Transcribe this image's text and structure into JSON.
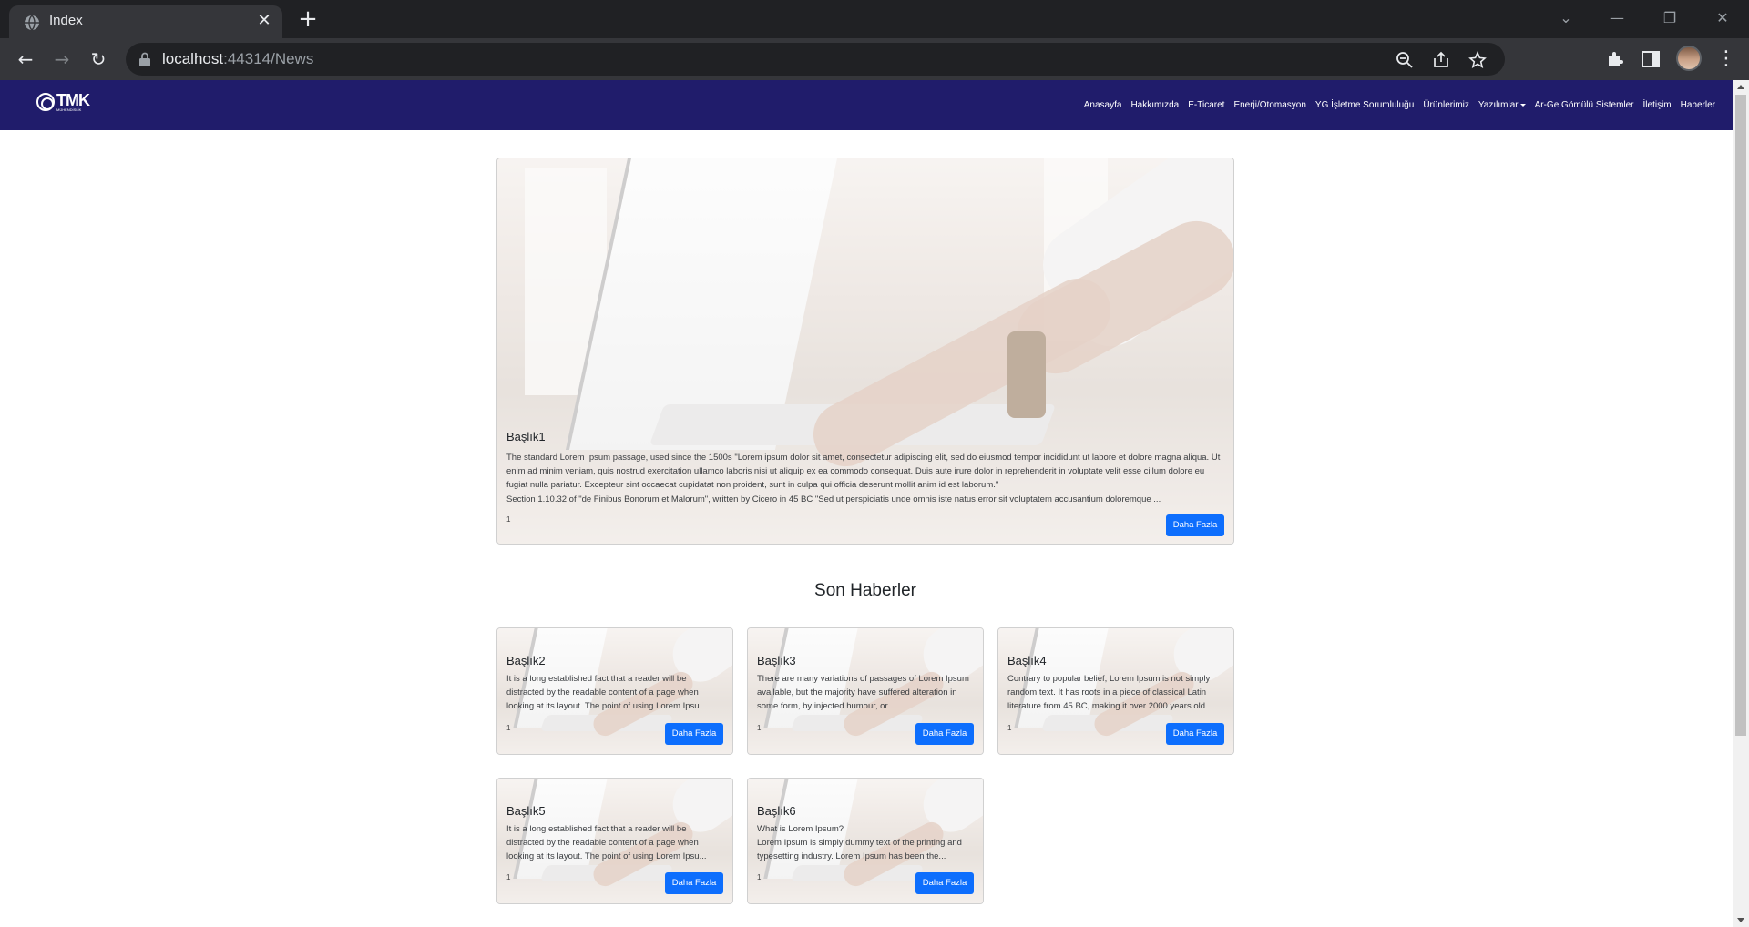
{
  "browser": {
    "tab_title": "Index",
    "url_host": "localhost",
    "url_rest": ":44314/News"
  },
  "site": {
    "logo_text": "TMK",
    "logo_sub": "MÜHENDİSLİK",
    "menu": [
      {
        "label": "Anasayfa"
      },
      {
        "label": "Hakkımızda"
      },
      {
        "label": "E-Ticaret"
      },
      {
        "label": "Enerji/Otomasyon"
      },
      {
        "label": "YG İşletme Sorumluluğu"
      },
      {
        "label": "Ürünlerimiz"
      },
      {
        "label": "Yazılımlar"
      },
      {
        "label": "Ar-Ge Gömülü Sistemler"
      },
      {
        "label": "İletişim"
      },
      {
        "label": "Haberler"
      }
    ]
  },
  "featured": {
    "title": "Başlık1",
    "text": "The standard Lorem Ipsum passage, used since the 1500s \"Lorem ipsum dolor sit amet, consectetur adipiscing elit, sed do eiusmod tempor incididunt ut labore et dolore magna aliqua. Ut enim ad minim veniam, quis nostrud exercitation ullamco laboris nisi ut aliquip ex ea commodo consequat. Duis aute irure dolor in reprehenderit in voluptate velit esse cillum dolore eu fugiat nulla pariatur. Excepteur sint occaecat cupidatat non proident, sunt in culpa qui officia deserunt mollit anim id est laborum.\"",
    "text2": "Section 1.10.32 of \"de Finibus Bonorum et Malorum\", written by Cicero in 45 BC \"Sed ut perspiciatis unde omnis iste natus error sit voluptatem accusantium doloremque ...",
    "num": "1",
    "button": "Daha Fazla"
  },
  "section_title": "Son Haberler",
  "news": [
    {
      "title": "Başlık2",
      "text": "It is a long established fact that a reader will be distracted by the readable content of a page when looking at its layout. The point of using Lorem Ipsu...",
      "num": "1",
      "button": "Daha Fazla"
    },
    {
      "title": "Başlık3",
      "text": "There are many variations of passages of Lorem Ipsum available, but the majority have suffered alteration in some form, by injected humour, or ...",
      "num": "1",
      "button": "Daha Fazla"
    },
    {
      "title": "Başlık4",
      "text": "Contrary to popular belief, Lorem Ipsum is not simply random text. It has roots in a piece of classical Latin literature from 45 BC, making it over 2000 years old....",
      "num": "1",
      "button": "Daha Fazla"
    },
    {
      "title": "Başlık5",
      "text": "It is a long established fact that a reader will be distracted by the readable content of a page when looking at its layout. The point of using Lorem Ipsu...",
      "num": "1",
      "button": "Daha Fazla"
    },
    {
      "title": "Başlık6",
      "text": "What is Lorem Ipsum?\nLorem Ipsum is simply dummy text of the printing and typesetting industry. Lorem Ipsum has been the...",
      "num": "1",
      "button": "Daha Fazla"
    }
  ]
}
